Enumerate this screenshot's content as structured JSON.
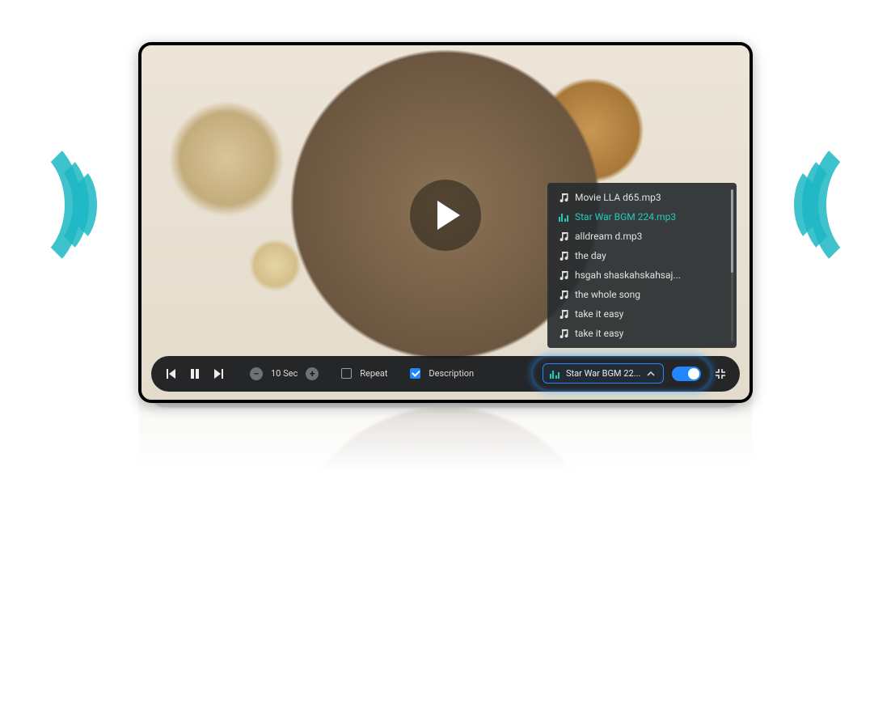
{
  "playlist": {
    "items": [
      {
        "label": "Movie LLA d65.mp3",
        "active": false
      },
      {
        "label": "Star War BGM 224.mp3",
        "active": true
      },
      {
        "label": "alldream d.mp3",
        "active": false
      },
      {
        "label": "the day",
        "active": false
      },
      {
        "label": "hsgah shaskahskahsaj...",
        "active": false
      },
      {
        "label": "the whole song",
        "active": false
      },
      {
        "label": "take it easy",
        "active": false
      },
      {
        "label": "take it easy",
        "active": false
      }
    ]
  },
  "controls": {
    "seek_step_label": "10 Sec",
    "repeat_label": "Repeat",
    "repeat_checked": false,
    "description_label": "Description",
    "description_checked": true,
    "current_track_label": "Star War BGM 22...",
    "music_toggle_on": true
  }
}
